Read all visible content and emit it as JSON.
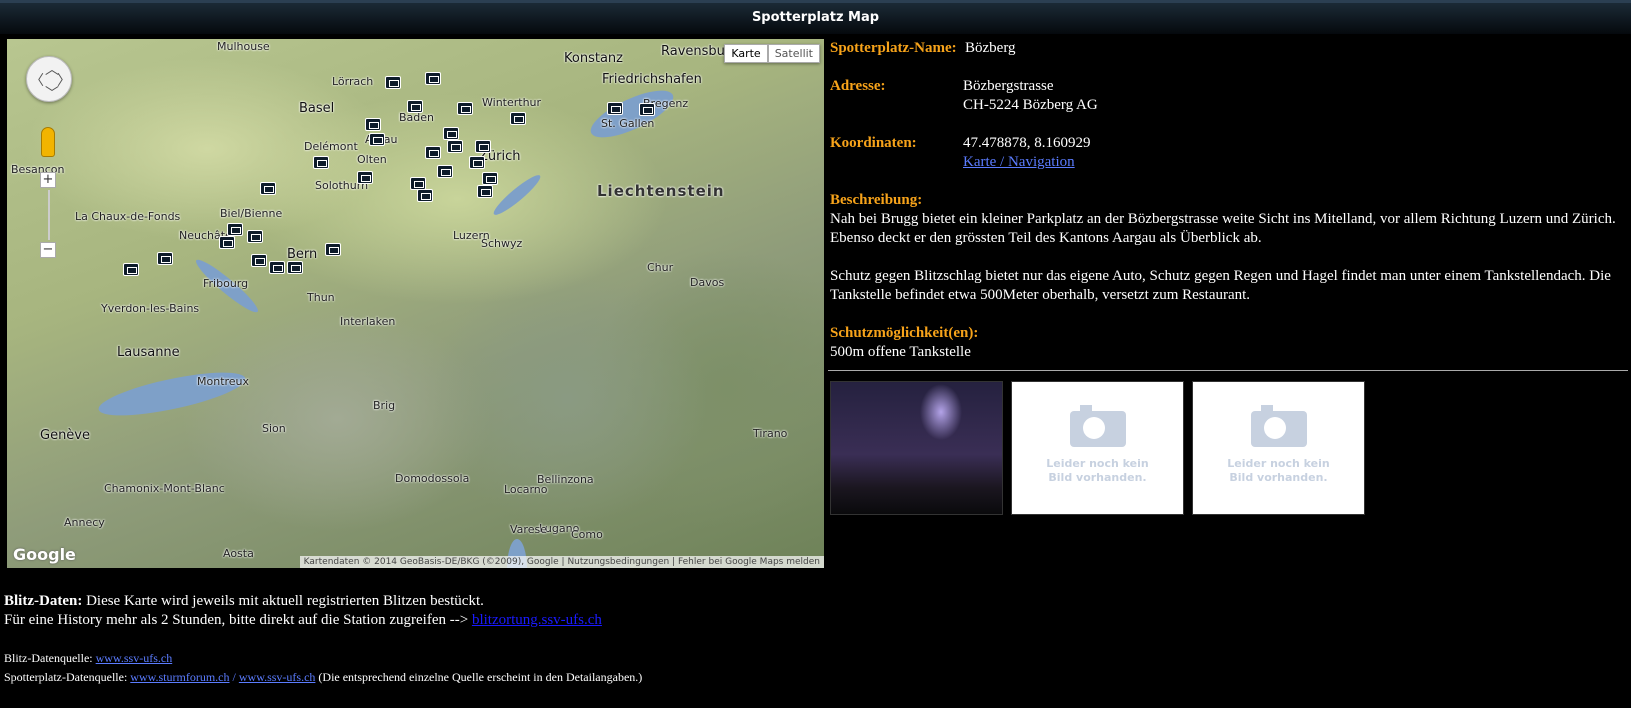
{
  "window": {
    "title": "Spotterplatz Map"
  },
  "map": {
    "type_buttons": [
      "Karte",
      "Satellit"
    ],
    "zoom_in": "+",
    "zoom_out": "−",
    "logo": "Google",
    "attribution": "Kartendaten © 2014 GeoBasis-DE/BKG (©2009), Google",
    "terms": "Nutzungsbedingungen",
    "report": "Fehler bei Google Maps melden",
    "cities": [
      "Mulhouse",
      "Basel",
      "Lörrach",
      "Konstanz",
      "Ravensburg",
      "Friedrichshafen",
      "Winterthur",
      "Baden",
      "Aarau",
      "Olten",
      "Zürich",
      "Delémont",
      "Solothurn",
      "Biel/Bienne",
      "Neuchâtel",
      "Bern",
      "Fribourg",
      "Thun",
      "Luzern",
      "Schwyz",
      "Liechtenstein",
      "St. Gallen",
      "Bregenz",
      "Chur",
      "Davos",
      "Lausanne",
      "Montreux",
      "Genève",
      "Sion",
      "Brig",
      "Bellinzona",
      "Lugano",
      "Locarno",
      "Como",
      "Varese",
      "Yverdon-les-Bains",
      "La Chaux-de-Fonds",
      "Besançon",
      "Annecy",
      "Chamonix-Mont-Blanc",
      "Domodossola",
      "Aosta",
      "Interlaken",
      "Tirano"
    ]
  },
  "info": {
    "name_label": "Spotterplatz-Name:",
    "name": "Bözberg",
    "address_label": "Adresse:",
    "address_line1": "Bözbergstrasse",
    "address_line2": "CH-5224 Bözberg AG",
    "coords_label": "Koordinaten:",
    "coords": "47.478878, 8.160929",
    "nav_link": "Karte / Navigation",
    "desc_label": "Beschreibung:",
    "desc_p1": "Nah bei Brugg bietet ein kleiner Parkplatz an der Bözbergstrasse weite Sicht ins Mitelland, vor allem Richtung Luzern und Zürich. Ebenso deckt er den grössten Teil des Kantons Aargau als Überblick ab.",
    "desc_p2": "Schutz gegen Blitzschlag bietet nur das eigene Auto, Schutz gegen Regen und Hagel findet man unter einem Tankstellendach. Die Tankstelle befindet etwa 500Meter oberhalb, versetzt zum Restaurant.",
    "protection_label": "Schutzmöglichkeit(en):",
    "protection": "500m offene Tankstelle",
    "no_image_line1": "Leider noch kein",
    "no_image_line2": "Bild vorhanden."
  },
  "footer": {
    "blitz_label": "Blitz-Daten:",
    "blitz_text": " Diese Karte wird jeweils mit aktuell registrierten Blitzen bestückt.",
    "history_text": "Für eine History mehr als 2 Stunden, bitte direkt auf die Station zugreifen --> ",
    "history_link": "blitzortung.ssv-ufs.ch",
    "source1_label": "Blitz-Datenquelle: ",
    "source1_link": "www.ssv-ufs.ch",
    "source2_label": "Spotterplatz-Datenquelle: ",
    "source2_link1": "www.sturmforum.ch",
    "source2_sep": " / ",
    "source2_link2": "www.ssv-ufs.ch",
    "source2_note": " (Die entsprechend einzelne Quelle erscheint in den Detailangaben.)"
  }
}
